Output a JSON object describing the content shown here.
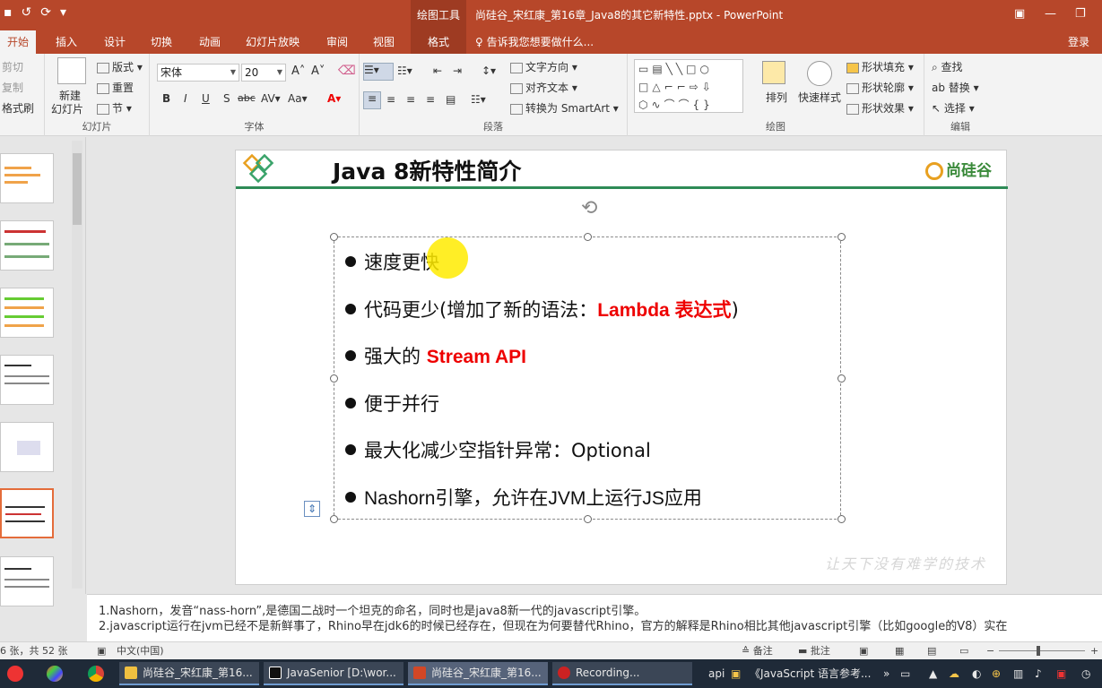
{
  "window": {
    "context_tools": "绘图工具",
    "title": "尚硅谷_宋红康_第16章_Java8的其它新特性.pptx - PowerPoint"
  },
  "tabs": [
    {
      "label": "开始",
      "active": true
    },
    {
      "label": "插入"
    },
    {
      "label": "设计"
    },
    {
      "label": "切换"
    },
    {
      "label": "动画"
    },
    {
      "label": "幻灯片放映"
    },
    {
      "label": "审阅"
    },
    {
      "label": "视图"
    },
    {
      "label": "格式"
    }
  ],
  "tell_me": "告诉我您想要做什么...",
  "login": "登录",
  "ribbon": {
    "clipboard": {
      "cut": "剪切",
      "copy": "复制",
      "format_painter": "格式刷"
    },
    "slides": {
      "new_slide_1": "新建",
      "new_slide_2": "幻灯片",
      "layout": "版式",
      "reset": "重置",
      "section": "节",
      "label": "幻灯片"
    },
    "font": {
      "name": "宋体",
      "size": "20",
      "label": "字体"
    },
    "paragraph": {
      "text_direction": "文字方向",
      "align_text": "对齐文本",
      "convert_smartart": "转换为 SmartArt",
      "label": "段落"
    },
    "drawing": {
      "arrange": "排列",
      "quick_styles": "快速样式",
      "shape_fill": "形状填充",
      "shape_outline": "形状轮廓",
      "shape_effects": "形状效果",
      "label": "绘图"
    },
    "editing": {
      "find": "查找",
      "replace": "替换",
      "select": "选择",
      "label": "编辑"
    }
  },
  "slide": {
    "title": "Java 8新特性简介",
    "brand": "尚硅谷",
    "watermark": "让天下没有难学的技术",
    "bullets": [
      {
        "text": "速度更快"
      },
      {
        "text": "代码更少(增加了新的语法：",
        "highlight": "Lambda 表达式",
        "tail": ")"
      },
      {
        "text": "强大的 ",
        "highlight": "Stream API",
        "tail": ""
      },
      {
        "text": "便于并行"
      },
      {
        "text": "最大化减少空指针异常：Optional"
      },
      {
        "text": "Nashorn引擎，允许在JVM上运行JS应用"
      }
    ]
  },
  "notes": {
    "line1": "1.Nashorn，发音“nass-horn”,是德国二战时一个坦克的命名，同时也是java8新一代的javascript引擎。",
    "line2": "2.javascript运行在jvm已经不是新鲜事了，Rhino早在jdk6的时候已经存在，但现在为何要替代Rhino，官方的解释是Rhino相比其他javascript引擎（比如google的V8）实在"
  },
  "status": {
    "slide_count": "6 张，共 52 张",
    "language": "中文(中国)",
    "notes_btn": "备注",
    "comments_btn": "批注"
  },
  "taskbar": {
    "apps": [
      {
        "label": "尚硅谷_宋红康_第16..."
      },
      {
        "label": "JavaSenior [D:\\wor..."
      },
      {
        "label": "尚硅谷_宋红康_第16..."
      },
      {
        "label": "Recording..."
      }
    ],
    "tray_text": "api",
    "browser_tab": "《JavaScript 语言参考..."
  },
  "colors": {
    "accent": "#b7472a",
    "highlight_red": "#e00000",
    "slide_rule": "#2e8b57"
  }
}
